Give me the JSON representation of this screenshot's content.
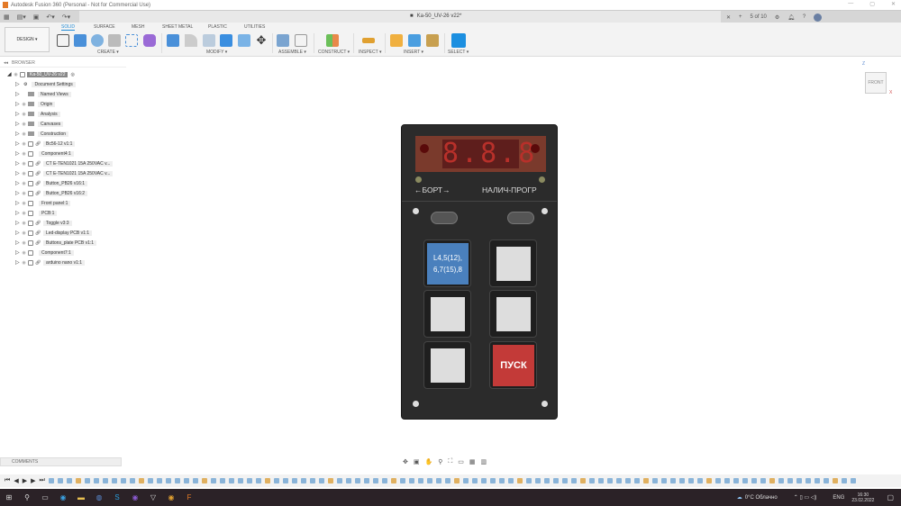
{
  "window": {
    "title": "Autodesk Fusion 360 (Personal - Not for Commercial Use)",
    "doc_tab": "Ka-50_UV-26 v22*",
    "job_status": "5 of 10"
  },
  "ribbon": {
    "workspace": "DESIGN ▾",
    "tabs": [
      "SOLID",
      "SURFACE",
      "MESH",
      "SHEET METAL",
      "PLASTIC",
      "UTILITIES"
    ],
    "active_tab": "SOLID",
    "groups": [
      "CREATE ▾",
      "MODIFY ▾",
      "ASSEMBLE ▾",
      "CONSTRUCT ▾",
      "INSPECT ▾",
      "INSERT ▾",
      "SELECT ▾"
    ]
  },
  "browser": {
    "title": "BROWSER",
    "root": "Ka-50_UV-26 v22",
    "items": [
      {
        "label": "Document Settings",
        "type": "settings"
      },
      {
        "label": "Named Views",
        "type": "folder"
      },
      {
        "label": "Origin",
        "type": "folder"
      },
      {
        "label": "Analysis",
        "type": "folder"
      },
      {
        "label": "Canvases",
        "type": "folder"
      },
      {
        "label": "Construction",
        "type": "folder"
      },
      {
        "label": "Bc56-12 v1:1",
        "type": "link"
      },
      {
        "label": "Component4:1",
        "type": "comp"
      },
      {
        "label": "CT E-TEN1021 15A 250VAC v...",
        "type": "link"
      },
      {
        "label": "CT E-TEN1021 15A 250VAC v...",
        "type": "link"
      },
      {
        "label": "Button_PB26 v16:1",
        "type": "link"
      },
      {
        "label": "Button_PB26 v16:2",
        "type": "link"
      },
      {
        "label": "Front panel:1",
        "type": "comp"
      },
      {
        "label": "PCB:1",
        "type": "comp"
      },
      {
        "label": "Toggle v3:3",
        "type": "link"
      },
      {
        "label": "Led-display PCB v1:1",
        "type": "link"
      },
      {
        "label": "Buttons_plate PCB v1:1",
        "type": "link"
      },
      {
        "label": "Component7:1",
        "type": "comp"
      },
      {
        "label": "arduino nano v1:1",
        "type": "link"
      }
    ]
  },
  "viewcube": {
    "face": "FRONT",
    "axis_z": "Z",
    "axis_x": "X"
  },
  "model": {
    "display": "8.8.8",
    "label_left": "←БОРТ→",
    "label_right": "НАЛИЧ-ПРОГР",
    "blue_line1": "L4,5(12),",
    "blue_line2": "6,7(15),8",
    "red_button": "ПУСК"
  },
  "comments": {
    "title": "COMMENTS"
  },
  "taskbar": {
    "weather": "0°C Облачно",
    "lang": "ENG",
    "time": "16:30",
    "date": "23.02.2022"
  }
}
